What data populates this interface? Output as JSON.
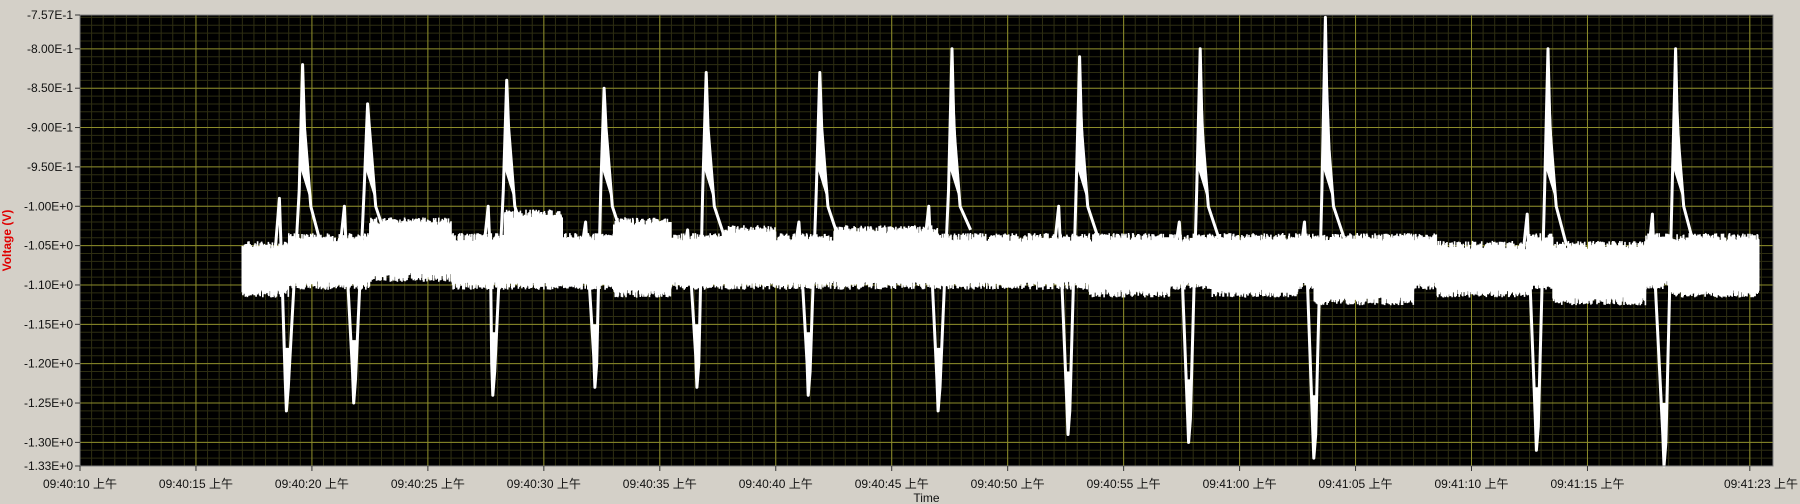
{
  "chart_data": {
    "type": "line",
    "title": "",
    "xlabel": "Time",
    "ylabel": "Voltage (V)",
    "y_axis_color": "#e00000",
    "plot_bg": "#000000",
    "grid_major_color": "#8c8c2a",
    "grid_minor_color": "#2e2e12",
    "trace_color": "#ffffff",
    "grid": true,
    "ylim": [
      -1.33,
      -0.757
    ],
    "xlim_seconds": [
      0,
      73
    ],
    "yticks": [
      {
        "value": -0.757,
        "label": "-7.57E-1"
      },
      {
        "value": -0.8,
        "label": "-8.00E-1"
      },
      {
        "value": -0.85,
        "label": "-8.50E-1"
      },
      {
        "value": -0.9,
        "label": "-9.00E-1"
      },
      {
        "value": -0.95,
        "label": "-9.50E-1"
      },
      {
        "value": -1.0,
        "label": "-1.00E+0"
      },
      {
        "value": -1.05,
        "label": "-1.05E+0"
      },
      {
        "value": -1.1,
        "label": "-1.10E+0"
      },
      {
        "value": -1.15,
        "label": "-1.15E+0"
      },
      {
        "value": -1.2,
        "label": "-1.20E+0"
      },
      {
        "value": -1.25,
        "label": "-1.25E+0"
      },
      {
        "value": -1.3,
        "label": "-1.30E+0"
      },
      {
        "value": -1.33,
        "label": "-1.33E+0"
      }
    ],
    "xticks": [
      {
        "value": 0,
        "label": "09:40:10 上午"
      },
      {
        "value": 5,
        "label": "09:40:15 上午"
      },
      {
        "value": 10,
        "label": "09:40:20 上午"
      },
      {
        "value": 15,
        "label": "09:40:25 上午"
      },
      {
        "value": 20,
        "label": "09:40:30 上午"
      },
      {
        "value": 25,
        "label": "09:40:35 上午"
      },
      {
        "value": 30,
        "label": "09:40:40 上午"
      },
      {
        "value": 35,
        "label": "09:40:45 上午"
      },
      {
        "value": 40,
        "label": "09:40:50 上午"
      },
      {
        "value": 45,
        "label": "09:40:55 上午"
      },
      {
        "value": 50,
        "label": "09:41:00 上午"
      },
      {
        "value": 55,
        "label": "09:41:05 上午"
      },
      {
        "value": 60,
        "label": "09:41:10 上午"
      },
      {
        "value": 65,
        "label": "09:41:15 上午"
      },
      {
        "value": 72,
        "label": "09:41:23 上午"
      }
    ],
    "series": [
      {
        "signal_start_seconds": 7.0,
        "signal_end_seconds": 72.4,
        "baseline_segments": [
          {
            "x0": 7.0,
            "x1": 9.0,
            "top": -1.05,
            "bottom": -1.11
          },
          {
            "x0": 9.5,
            "x1": 11.5,
            "top": -1.04,
            "bottom": -1.1
          },
          {
            "x0": 12.5,
            "x1": 16.0,
            "top": -1.02,
            "bottom": -1.09
          },
          {
            "x0": 18.3,
            "x1": 20.8,
            "top": -1.01,
            "bottom": -1.1
          },
          {
            "x0": 23.0,
            "x1": 25.5,
            "top": -1.02,
            "bottom": -1.11
          },
          {
            "x0": 27.8,
            "x1": 30.0,
            "top": -1.03,
            "bottom": -1.1
          },
          {
            "x0": 32.5,
            "x1": 37.0,
            "top": -1.03,
            "bottom": -1.1
          },
          {
            "x0": 37.5,
            "x1": 42.0,
            "top": -1.04,
            "bottom": -1.1
          },
          {
            "x0": 43.5,
            "x1": 47.0,
            "top": -1.04,
            "bottom": -1.11
          },
          {
            "x0": 48.8,
            "x1": 52.5,
            "top": -1.04,
            "bottom": -1.11
          },
          {
            "x0": 53.2,
            "x1": 57.5,
            "top": -1.04,
            "bottom": -1.12
          },
          {
            "x0": 58.5,
            "x1": 62.5,
            "top": -1.05,
            "bottom": -1.11
          },
          {
            "x0": 63.5,
            "x1": 67.5,
            "top": -1.05,
            "bottom": -1.12
          },
          {
            "x0": 68.5,
            "x1": 72.4,
            "top": -1.04,
            "bottom": -1.11
          }
        ],
        "beats": [
          {
            "t_pre": 8.6,
            "pre": -0.99,
            "t_trough": 8.9,
            "trough": -1.26,
            "t_peak": 9.6,
            "peak": -0.82
          },
          {
            "t_pre": 11.4,
            "pre": -1.0,
            "t_trough": 11.8,
            "trough": -1.25,
            "t_peak": 12.4,
            "peak": -0.87
          },
          {
            "t_pre": 17.6,
            "pre": -1.0,
            "t_trough": 17.8,
            "trough": -1.24,
            "t_peak": 18.4,
            "peak": -0.84
          },
          {
            "t_pre": 21.8,
            "pre": -1.02,
            "t_trough": 22.2,
            "trough": -1.23,
            "t_peak": 22.6,
            "peak": -0.85
          },
          {
            "t_pre": 26.2,
            "pre": -1.03,
            "t_trough": 26.6,
            "trough": -1.23,
            "t_peak": 27.0,
            "peak": -0.83
          },
          {
            "t_pre": 31.0,
            "pre": -1.02,
            "t_trough": 31.4,
            "trough": -1.24,
            "t_peak": 31.9,
            "peak": -0.83
          },
          {
            "t_pre": 36.6,
            "pre": -1.0,
            "t_trough": 37.0,
            "trough": -1.26,
            "t_peak": 37.6,
            "peak": -0.8
          },
          {
            "t_pre": 42.2,
            "pre": -1.0,
            "t_trough": 42.6,
            "trough": -1.29,
            "t_peak": 43.1,
            "peak": -0.81
          },
          {
            "t_pre": 47.4,
            "pre": -1.02,
            "t_trough": 47.8,
            "trough": -1.3,
            "t_peak": 48.3,
            "peak": -0.8
          },
          {
            "t_pre": 52.8,
            "pre": -1.02,
            "t_trough": 53.2,
            "trough": -1.32,
            "t_peak": 53.7,
            "peak": -0.76
          },
          {
            "t_pre": 62.4,
            "pre": -1.01,
            "t_trough": 62.8,
            "trough": -1.31,
            "t_peak": 63.3,
            "peak": -0.8
          },
          {
            "t_pre": 67.8,
            "pre": -1.01,
            "t_trough": 68.3,
            "trough": -1.33,
            "t_peak": 68.8,
            "peak": -0.8
          }
        ]
      }
    ]
  }
}
